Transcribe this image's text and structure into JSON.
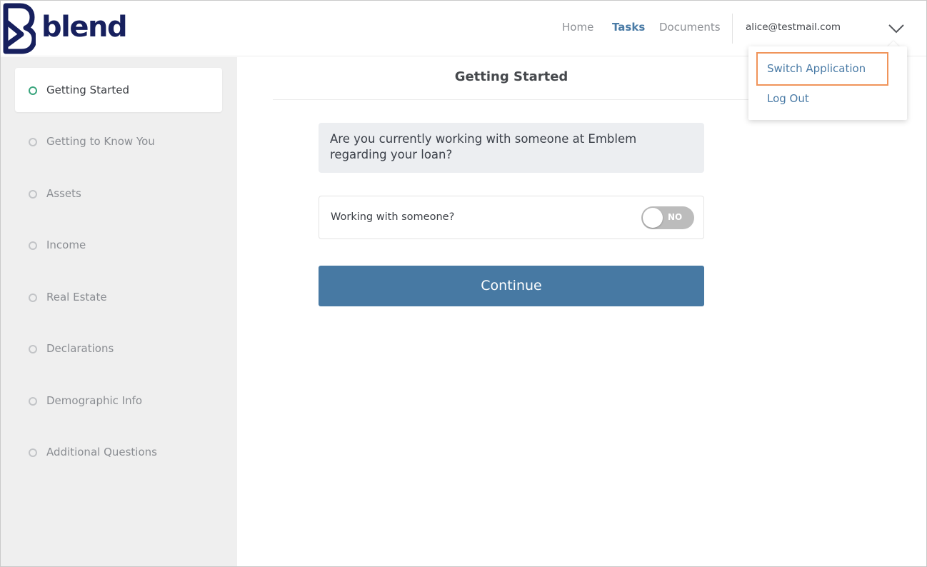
{
  "brand": {
    "name": "blend",
    "color": "#17205e"
  },
  "nav": {
    "home": "Home",
    "tasks": "Tasks",
    "documents": "Documents",
    "active": "Tasks"
  },
  "user": {
    "email": "alice@testmail.com"
  },
  "user_menu": {
    "switch_application": "Switch Application",
    "log_out": "Log Out",
    "highlighted_item": "Switch Application"
  },
  "sidebar": {
    "items": [
      {
        "label": "Getting Started",
        "active": true
      },
      {
        "label": "Getting to Know You",
        "active": false
      },
      {
        "label": "Assets",
        "active": false
      },
      {
        "label": "Income",
        "active": false
      },
      {
        "label": "Real Estate",
        "active": false
      },
      {
        "label": "Declarations",
        "active": false
      },
      {
        "label": "Demographic Info",
        "active": false
      },
      {
        "label": "Additional Questions",
        "active": false
      }
    ]
  },
  "main": {
    "title": "Getting Started",
    "question": "Are you currently working with someone at Emblem regarding your loan?",
    "toggle": {
      "label": "Working with someone?",
      "state_text": "NO",
      "checked": false
    },
    "continue_label": "Continue"
  },
  "colors": {
    "accent": "#4779a3",
    "active_dot": "#3aa57d",
    "highlight": "#f0945a"
  }
}
